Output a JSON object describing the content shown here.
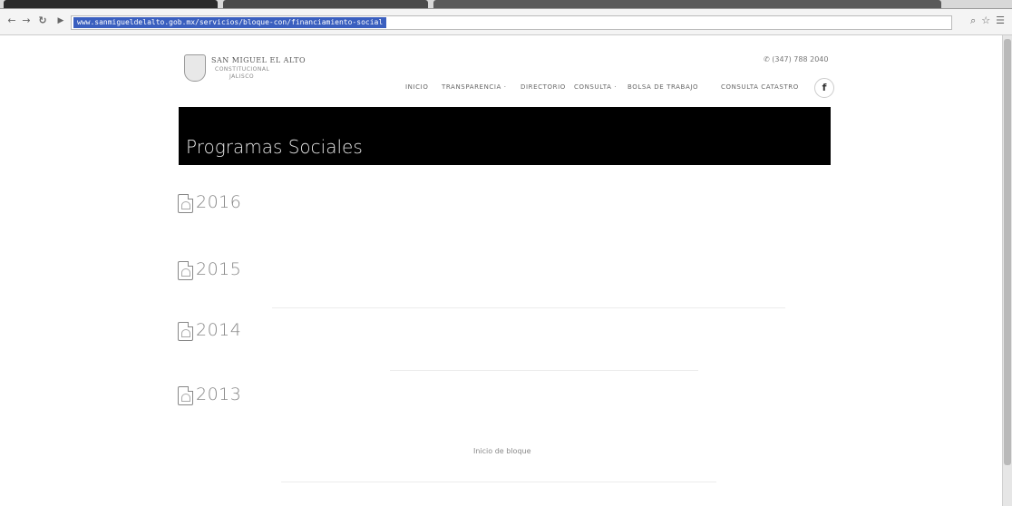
{
  "browser": {
    "nav": {
      "back_icon": "arrow-left-icon",
      "forward_icon": "arrow-right-icon",
      "reload_icon": "reload-icon"
    },
    "url_selected": "www.sanmigueldelalto.gob.mx/servicios/bloque-con/financiamiento-social",
    "tools": {
      "zoom_icon": "zoom-icon",
      "star_icon": "star-icon",
      "menu_icon": "hamburger-menu-icon"
    }
  },
  "header": {
    "logo": {
      "title": "SAN MIGUEL EL ALTO",
      "subtitle": "CONSTITUCIONAL",
      "subtitle2": "JALISCO"
    },
    "phone": "✆ (347) 788 2040",
    "menu": [
      "INICIO",
      "TRANSPARENCIA ·",
      "DIRECTORIO",
      "CONSULTA ·",
      "BOLSA DE TRABAJO",
      "CONSULTA CATASTRO"
    ],
    "facebook_label": "f"
  },
  "banner": {
    "title": "Programas Sociales"
  },
  "years": [
    {
      "label": "2016"
    },
    {
      "label": "2015"
    },
    {
      "label": "2014"
    },
    {
      "label": "2013"
    }
  ],
  "footer": {
    "link": "Inicio de bloque"
  },
  "colors": {
    "banner_bg": "#000000",
    "url_highlight": "#3a5fbf",
    "year_text": "#888888"
  }
}
